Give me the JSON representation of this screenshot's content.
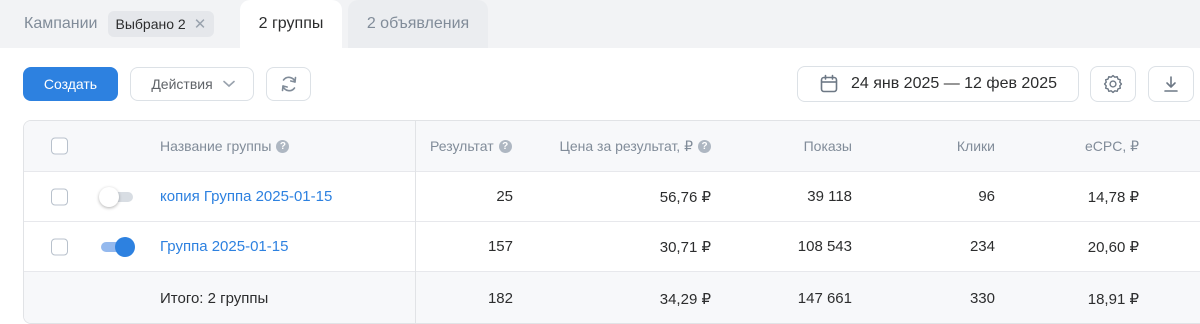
{
  "tabs": {
    "campaigns_label": "Кампании",
    "selected_chip": "Выбрано 2",
    "chip_close": "✕",
    "groups_label": "2 группы",
    "ads_label": "2 объявления"
  },
  "toolbar": {
    "create_label": "Создать",
    "actions_label": "Действия",
    "date_range": "24 янв 2025 — 12 фев 2025"
  },
  "table": {
    "headers": {
      "name": "Название группы",
      "result": "Результат",
      "price": "Цена за результат, ₽",
      "shows": "Показы",
      "clicks": "Клики",
      "ecpc": "eCPC, ₽"
    },
    "help_glyph": "?",
    "rows": [
      {
        "name": "копия Группа 2025-01-15",
        "active": false,
        "result": "25",
        "price": "56,76 ₽",
        "shows": "39 118",
        "clicks": "96",
        "ecpc": "14,78 ₽"
      },
      {
        "name": "Группа 2025-01-15",
        "active": true,
        "result": "157",
        "price": "30,71 ₽",
        "shows": "108 543",
        "clicks": "234",
        "ecpc": "20,60 ₽"
      }
    ],
    "total": {
      "label": "Итого: 2 группы",
      "result": "182",
      "price": "34,29 ₽",
      "shows": "147 661",
      "clicks": "330",
      "ecpc": "18,91 ₽"
    }
  },
  "colors": {
    "accent": "#2d81e0",
    "muted": "#818c99",
    "background_tabs": "#f2f3f5"
  },
  "icons": [
    "close-icon",
    "chevron-down-icon",
    "refresh-icon",
    "calendar-icon",
    "gear-icon",
    "download-icon",
    "help-icon"
  ]
}
